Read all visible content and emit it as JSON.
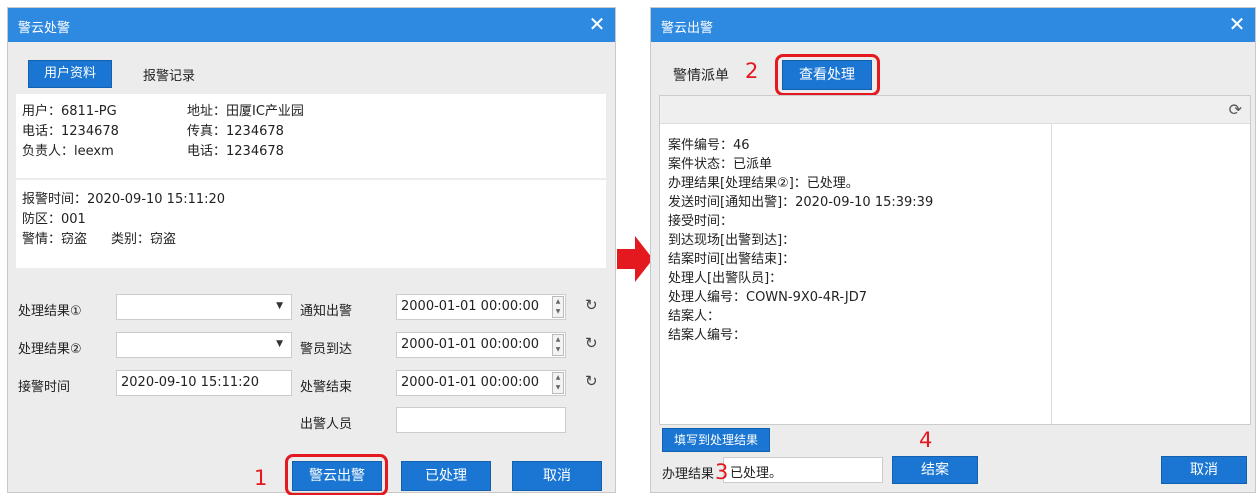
{
  "dialog1": {
    "title": "警云处警",
    "tabs": [
      "用户资料",
      "报警记录"
    ],
    "user_info": {
      "user": "用户：6811-PG",
      "address": "地址：田厦IC产业园",
      "phone": "电话：1234678",
      "fax": "传真：1234678",
      "manager": "负责人：leexm",
      "phone2": "电话：1234678"
    },
    "alarm_info": {
      "time": "报警时间：2020-09-10 15:11:20",
      "zone": "防区：001",
      "situation": "警情：窃盗",
      "category": "类别：窃盗"
    },
    "form": {
      "result1_label": "处理结果①",
      "result2_label": "处理结果②",
      "receive_time_label": "接警时间",
      "receive_time_value": "2020-09-10 15:11:20",
      "notify_label": "通知出警",
      "notify_value": "2000-01-01 00:00:00",
      "arrive_label": "警员到达",
      "arrive_value": "2000-01-01 00:00:00",
      "finish_label": "处警结束",
      "finish_value": "2000-01-01 00:00:00",
      "staff_label": "出警人员"
    },
    "buttons": {
      "dispatch": "警云出警",
      "processed": "已处理",
      "cancel": "取消"
    },
    "step_marker": "1"
  },
  "dialog2": {
    "title": "警云出警",
    "tab_label": "警情派单",
    "view_button": "查看处理",
    "step_marker_2": "2",
    "details": [
      "案件编号：46",
      "案件状态：已派单",
      "办理结果[处理结果②]：已处理。",
      "发送时间[通知出警]：2020-09-10 15:39:39",
      "接受时间：",
      "到达现场[出警到达]：",
      "结案时间[出警结束]：",
      "处理人[出警队员]：",
      "处理人编号：COWN-9X0-4R-JD7",
      "结案人：",
      "结案人编号："
    ],
    "fill_button": "填写到处理结果",
    "result_label": "办理结果",
    "result_value": "已处理。",
    "step_marker_3": "3",
    "step_marker_4": "4",
    "close_case_button": "结案",
    "cancel_button": "取消"
  },
  "colors": {
    "titlebar": "#2e8ae0",
    "button_blue": "#1a76d2",
    "highlight_red": "#e3191f"
  }
}
